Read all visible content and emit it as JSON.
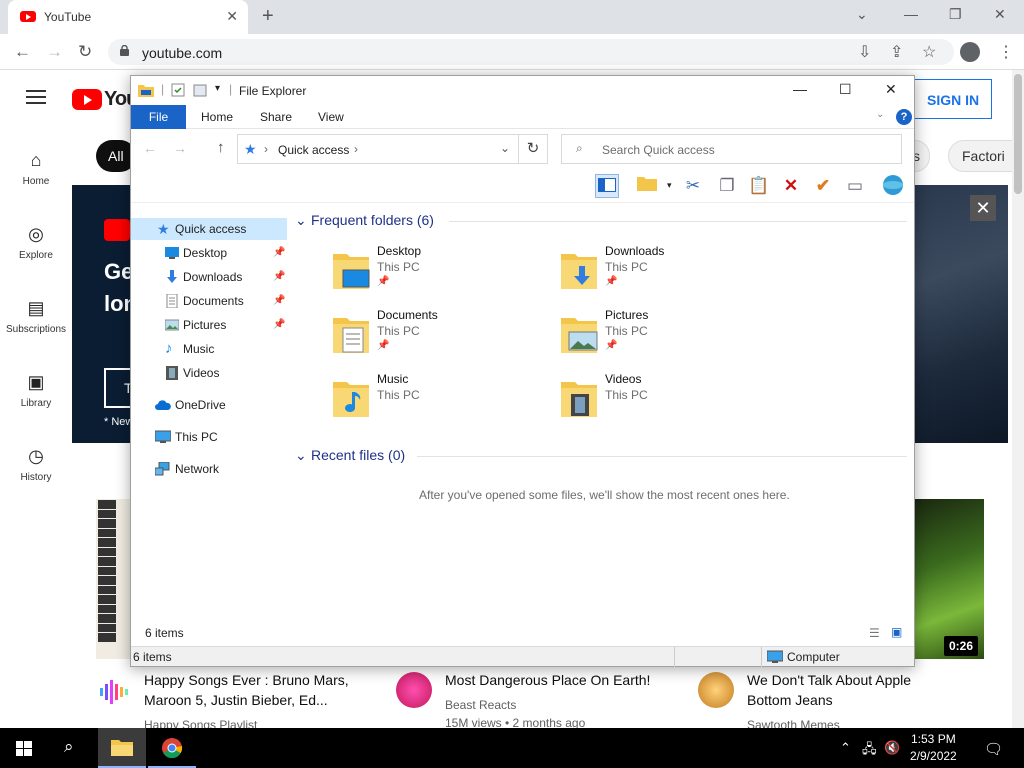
{
  "browser": {
    "tab_title": "YouTube",
    "url": "youtube.com"
  },
  "youtube": {
    "logo_text": "You",
    "sign_in": "SIGN IN",
    "nav": [
      {
        "label": "Home",
        "icon": "home-icon"
      },
      {
        "label": "Explore",
        "icon": "compass-icon"
      },
      {
        "label": "Subscriptions",
        "icon": "subscriptions-icon"
      },
      {
        "label": "Library",
        "icon": "library-icon"
      },
      {
        "label": "History",
        "icon": "history-icon"
      }
    ],
    "chips": {
      "first": "All",
      "middle": "s",
      "last": "Factori"
    },
    "banner": {
      "line1": "Ge",
      "line2": "lon",
      "button": "T",
      "note": "* New"
    },
    "videos": [
      {
        "title": "Happy Songs Ever : Bruno Mars, Maroon 5, Justin Bieber, Ed...",
        "channel": "Happy Songs Playlist",
        "views": ""
      },
      {
        "title": "Most Dangerous Place On Earth!",
        "channel": "Beast Reacts",
        "views": "15M views • 2 months ago"
      },
      {
        "title": "We Don't Talk About Apple Bottom Jeans",
        "channel": "Sawtooth Memes",
        "views": ""
      }
    ],
    "duration": "0:26"
  },
  "explorer": {
    "title": "File Explorer",
    "ribbon_tabs": [
      "File",
      "Home",
      "Share",
      "View"
    ],
    "help": "?",
    "address": "Quick access",
    "search_placeholder": "Search Quick access",
    "nav": [
      {
        "label": "Quick access",
        "pinned": false
      },
      {
        "label": "Desktop",
        "pinned": true
      },
      {
        "label": "Downloads",
        "pinned": true
      },
      {
        "label": "Documents",
        "pinned": true
      },
      {
        "label": "Pictures",
        "pinned": true
      },
      {
        "label": "Music",
        "pinned": false
      },
      {
        "label": "Videos",
        "pinned": false
      },
      {
        "label": "OneDrive",
        "pinned": false
      },
      {
        "label": "This PC",
        "pinned": false
      },
      {
        "label": "Network",
        "pinned": false
      }
    ],
    "frequent_header": "Frequent folders (6)",
    "folders": [
      {
        "name": "Desktop",
        "location": "This PC",
        "pinned": true
      },
      {
        "name": "Downloads",
        "location": "This PC",
        "pinned": true
      },
      {
        "name": "Documents",
        "location": "This PC",
        "pinned": true
      },
      {
        "name": "Pictures",
        "location": "This PC",
        "pinned": true
      },
      {
        "name": "Music",
        "location": "This PC",
        "pinned": false
      },
      {
        "name": "Videos",
        "location": "This PC",
        "pinned": false
      }
    ],
    "recent_header": "Recent files (0)",
    "recent_message": "After you've opened some files, we'll show the most recent ones here.",
    "item_count": "6 items",
    "status_count": "6 items",
    "status_location": "Computer"
  },
  "taskbar": {
    "time": "1:53 PM",
    "date": "2/9/2022"
  },
  "colors": {
    "explorer_accent": "#1a64c8",
    "youtube_red": "#ff0000",
    "selection": "#cce8ff"
  }
}
